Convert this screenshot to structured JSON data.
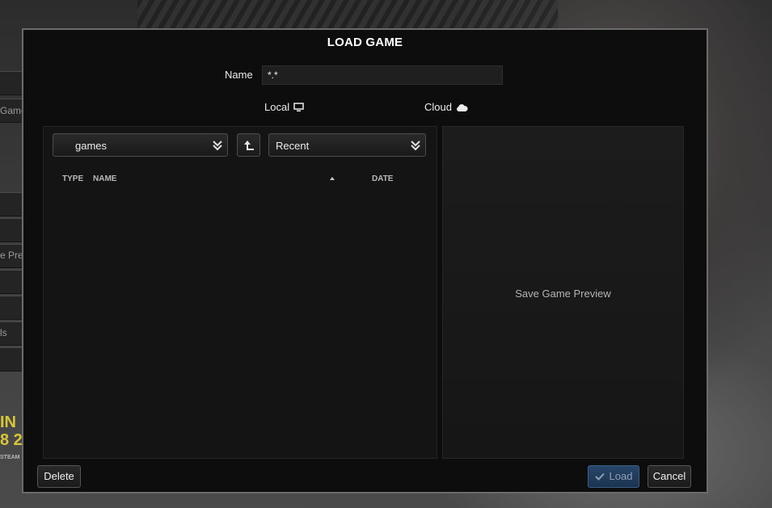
{
  "background": {
    "side_labels": [
      "Game",
      "e Pre",
      "ls"
    ]
  },
  "dialog": {
    "title": "LOAD GAME",
    "name_label": "Name",
    "name_value": "*.*",
    "tabs": [
      {
        "label": "Local",
        "icon": "monitor-icon"
      },
      {
        "label": "Cloud",
        "icon": "cloud-icon"
      }
    ],
    "folder_dropdown": {
      "value": "games",
      "icon": "chevron-double-down-icon"
    },
    "up_button_icon": "arrow-up-left-icon",
    "sort_dropdown": {
      "value": "Recent",
      "icon": "chevron-double-down-icon"
    },
    "columns": {
      "type": "TYPE",
      "name": "NAME",
      "date": "DATE",
      "sort_direction": "ascending"
    },
    "files": [],
    "preview_label": "Save Game Preview",
    "buttons": {
      "delete": "Delete",
      "load": "Load",
      "cancel": "Cancel"
    }
  },
  "colors": {
    "dialog_bg": "#0d0d0d",
    "panel_bg": "#141414",
    "load_button_bg": "#223c5e",
    "border": "#6b6b6b"
  }
}
